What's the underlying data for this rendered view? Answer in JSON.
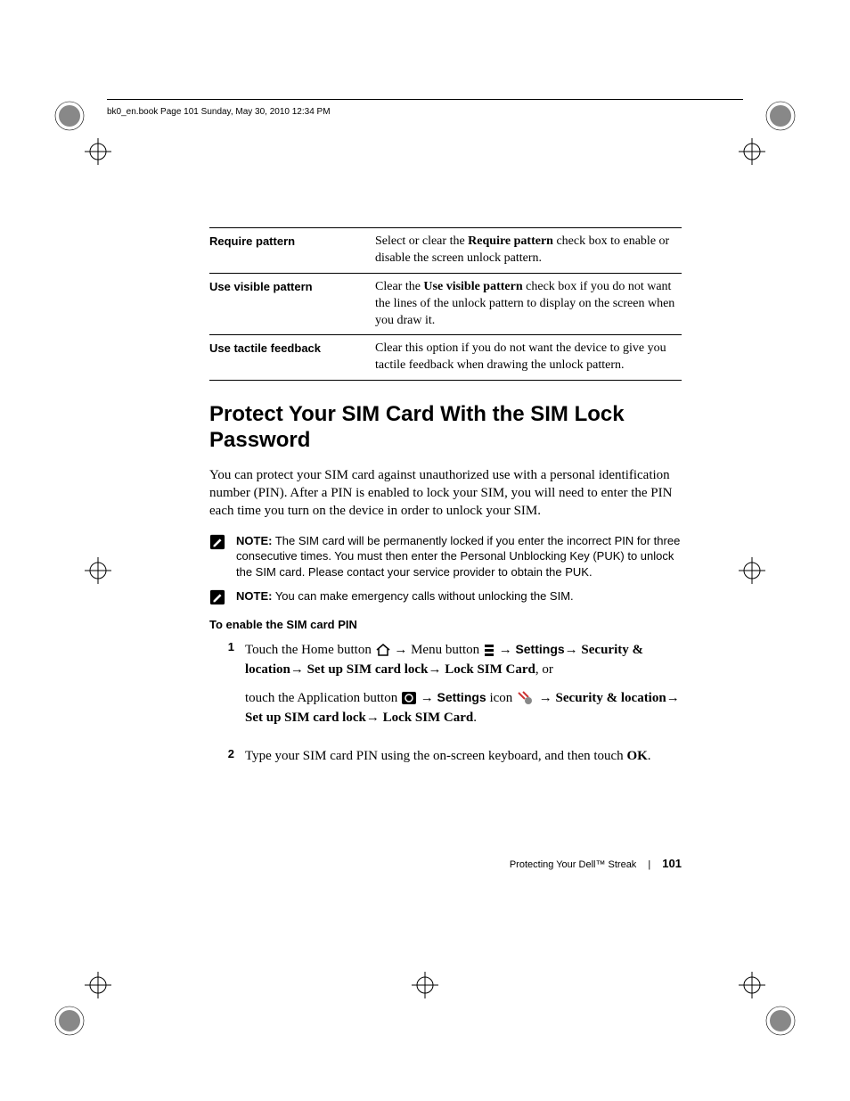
{
  "header": "bk0_en.book  Page 101  Sunday, May 30, 2010  12:34 PM",
  "table": {
    "rows": [
      {
        "label": "Require pattern",
        "desc_pre": "Select or clear the ",
        "desc_bold": "Require pattern",
        "desc_post": " check box to enable or disable the screen unlock pattern."
      },
      {
        "label": "Use visible pattern",
        "desc_pre": "Clear the ",
        "desc_bold": "Use visible pattern",
        "desc_post": " check box if you do not want the lines of the unlock pattern to display on the screen when you draw it."
      },
      {
        "label": "Use tactile feedback",
        "desc_pre": "",
        "desc_bold": "",
        "desc_post": "Clear this option if you do not want the device to give you tactile feedback when drawing the unlock pattern."
      }
    ]
  },
  "heading": "Protect Your SIM Card With the SIM Lock Password",
  "intro": "You can protect your SIM card against unauthorized use with a personal identification number (PIN). After a PIN is enabled to lock your SIM, you will need to enter the PIN each time you turn on the device in order to unlock your SIM.",
  "notes": {
    "label": "NOTE:",
    "n1": " The SIM card will be permanently locked if you enter the incorrect PIN for three consecutive times. You must then enter the Personal Unblocking Key (PUK) to unlock the SIM card. Please contact your service provider to obtain the PUK.",
    "n2": " You can make emergency calls without unlocking the SIM."
  },
  "subhead": "To enable the SIM card PIN",
  "steps": {
    "s1": {
      "num": "1",
      "a1": "Touch the Home button ",
      "a2": " Menu button ",
      "a3_bold": "Settings",
      "a4_bold": " Security & location",
      "a5_bold": " Set up SIM card lock",
      "a6_bold": " Lock SIM Card",
      "a7": ", or",
      "b1": "touch the Application button ",
      "b2_bold": "Settings",
      "b3": " icon ",
      "b4_bold": " Security & location",
      "b5_bold": " Set up SIM card lock",
      "b6_bold": " Lock SIM Card",
      "b7": "."
    },
    "s2": {
      "num": "2",
      "text_a": "Type your SIM card PIN using the on-screen keyboard, and then touch ",
      "text_bold": "OK",
      "text_b": "."
    }
  },
  "footer": {
    "title": "Protecting Your Dell™ Streak",
    "page": "101"
  },
  "arrow": "→"
}
